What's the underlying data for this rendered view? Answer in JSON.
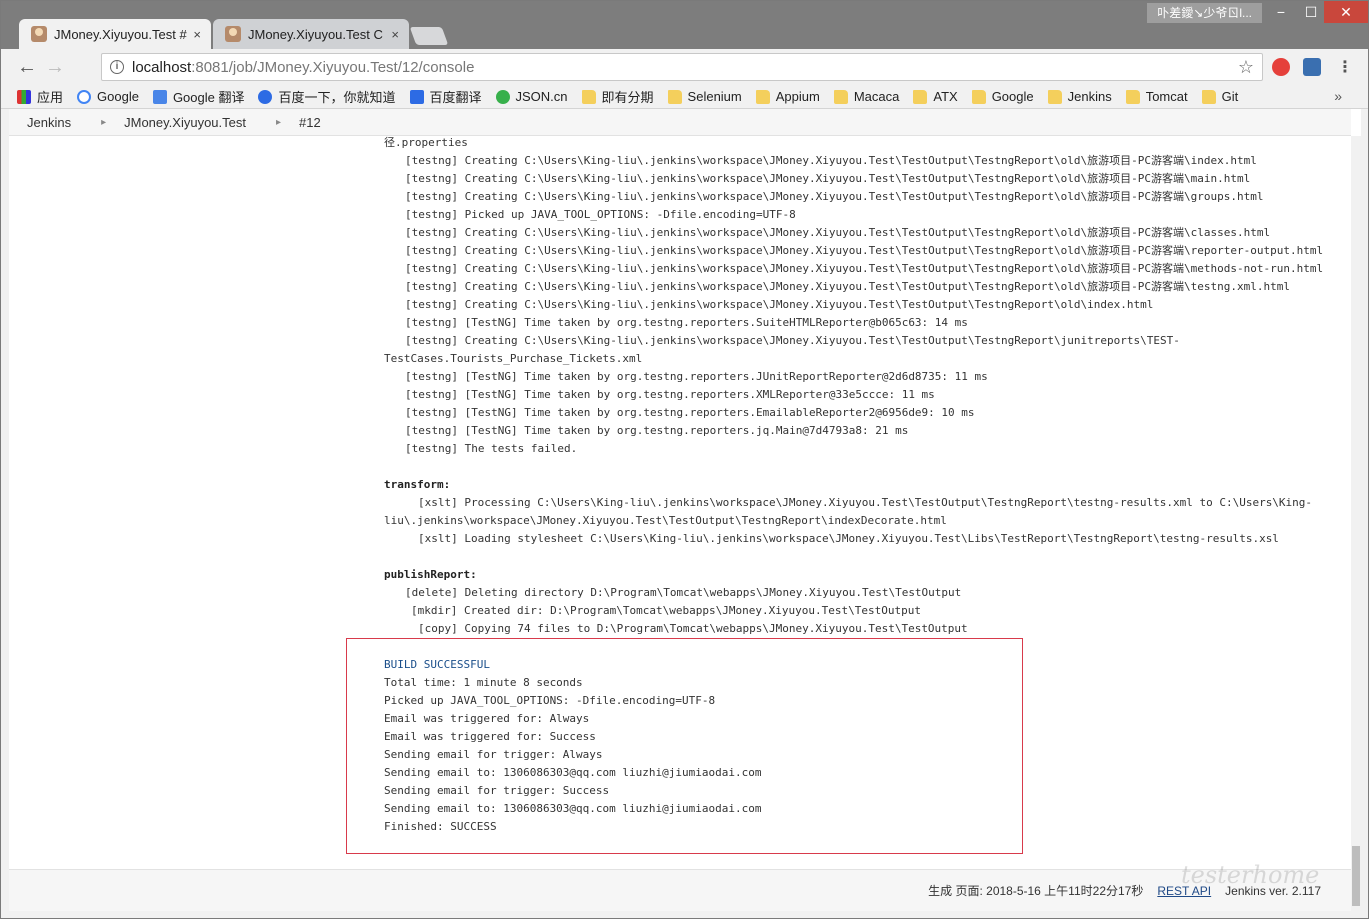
{
  "tabs": [
    {
      "title": "JMoney.Xiyuyou.Test #",
      "close": "×"
    },
    {
      "title": "JMoney.Xiyuyou.Test C",
      "close": "×"
    }
  ],
  "window": {
    "user": "卟差鑀↘少爷ㄖl...",
    "min": "−",
    "max": "☐",
    "close": "✕"
  },
  "toolbar": {
    "back": "←",
    "forward": "→",
    "reload": "C",
    "url_host": "localhost",
    "url_path": ":8081/job/JMoney.Xiyuyou.Test/12/console",
    "star": "☆",
    "menu": "⋮"
  },
  "bookmarks": {
    "items": [
      {
        "label": "应用",
        "icon": "apps-icon"
      },
      {
        "label": "Google",
        "icon": "google-icon"
      },
      {
        "label": "Google 翻译",
        "icon": "google-translate-icon"
      },
      {
        "label": "百度一下，你就知道",
        "icon": "baidu-icon"
      },
      {
        "label": "百度翻译",
        "icon": "baidu-translate-icon"
      },
      {
        "label": "JSON.cn",
        "icon": "json-icon"
      },
      {
        "label": "即有分期",
        "icon": "folder-icon"
      },
      {
        "label": "Selenium",
        "icon": "folder-icon"
      },
      {
        "label": "Appium",
        "icon": "folder-icon"
      },
      {
        "label": "Macaca",
        "icon": "folder-icon"
      },
      {
        "label": "ATX",
        "icon": "folder-icon"
      },
      {
        "label": "Google",
        "icon": "folder-icon"
      },
      {
        "label": "Jenkins",
        "icon": "folder-icon"
      },
      {
        "label": "Tomcat",
        "icon": "folder-icon"
      },
      {
        "label": "Git",
        "icon": "folder-icon"
      }
    ],
    "more": "»"
  },
  "breadcrumb": {
    "items": [
      "Jenkins",
      "JMoney.Xiyuyou.Test",
      "#12"
    ],
    "sep": "▸"
  },
  "console": {
    "lines": [
      {
        "text": "径.properties",
        "cls": ""
      },
      {
        "text": "[testng] Creating C:\\Users\\King-liu\\.jenkins\\workspace\\JMoney.Xiyuyou.Test\\TestOutput\\TestngReport\\old\\旅游项目-PC游客端\\index.html",
        "cls": "ind1"
      },
      {
        "text": "[testng] Creating C:\\Users\\King-liu\\.jenkins\\workspace\\JMoney.Xiyuyou.Test\\TestOutput\\TestngReport\\old\\旅游项目-PC游客端\\main.html",
        "cls": "ind1"
      },
      {
        "text": "[testng] Creating C:\\Users\\King-liu\\.jenkins\\workspace\\JMoney.Xiyuyou.Test\\TestOutput\\TestngReport\\old\\旅游项目-PC游客端\\groups.html",
        "cls": "ind1"
      },
      {
        "text": "[testng] Picked up JAVA_TOOL_OPTIONS: -Dfile.encoding=UTF-8",
        "cls": "ind1"
      },
      {
        "text": "[testng] Creating C:\\Users\\King-liu\\.jenkins\\workspace\\JMoney.Xiyuyou.Test\\TestOutput\\TestngReport\\old\\旅游项目-PC游客端\\classes.html",
        "cls": "ind1"
      },
      {
        "text": "[testng] Creating C:\\Users\\King-liu\\.jenkins\\workspace\\JMoney.Xiyuyou.Test\\TestOutput\\TestngReport\\old\\旅游项目-PC游客端\\reporter-output.html",
        "cls": "ind1"
      },
      {
        "text": "[testng] Creating C:\\Users\\King-liu\\.jenkins\\workspace\\JMoney.Xiyuyou.Test\\TestOutput\\TestngReport\\old\\旅游项目-PC游客端\\methods-not-run.html",
        "cls": "ind1"
      },
      {
        "text": "[testng] Creating C:\\Users\\King-liu\\.jenkins\\workspace\\JMoney.Xiyuyou.Test\\TestOutput\\TestngReport\\old\\旅游项目-PC游客端\\testng.xml.html",
        "cls": "ind1"
      },
      {
        "text": "[testng] Creating C:\\Users\\King-liu\\.jenkins\\workspace\\JMoney.Xiyuyou.Test\\TestOutput\\TestngReport\\old\\index.html",
        "cls": "ind1"
      },
      {
        "text": "[testng] [TestNG] Time taken by org.testng.reporters.SuiteHTMLReporter@b065c63: 14 ms",
        "cls": "ind1"
      },
      {
        "text": "[testng] Creating C:\\Users\\King-liu\\.jenkins\\workspace\\JMoney.Xiyuyou.Test\\TestOutput\\TestngReport\\junitreports\\TEST-",
        "cls": "ind1"
      },
      {
        "text": "TestCases.Tourists_Purchase_Tickets.xml",
        "cls": ""
      },
      {
        "text": "[testng] [TestNG] Time taken by org.testng.reporters.JUnitReportReporter@2d6d8735: 11 ms",
        "cls": "ind1"
      },
      {
        "text": "[testng] [TestNG] Time taken by org.testng.reporters.XMLReporter@33e5ccce: 11 ms",
        "cls": "ind1"
      },
      {
        "text": "[testng] [TestNG] Time taken by org.testng.reporters.EmailableReporter2@6956de9: 10 ms",
        "cls": "ind1"
      },
      {
        "text": "[testng] [TestNG] Time taken by org.testng.reporters.jq.Main@7d4793a8: 21 ms",
        "cls": "ind1"
      },
      {
        "text": "[testng] The tests failed.",
        "cls": "ind1"
      },
      {
        "text": "",
        "cls": "gap"
      },
      {
        "text": "transform:",
        "cls": "b"
      },
      {
        "text": "[xslt] Processing C:\\Users\\King-liu\\.jenkins\\workspace\\JMoney.Xiyuyou.Test\\TestOutput\\TestngReport\\testng-results.xml to C:\\Users\\King-",
        "cls": "ind2"
      },
      {
        "text": "liu\\.jenkins\\workspace\\JMoney.Xiyuyou.Test\\TestOutput\\TestngReport\\indexDecorate.html",
        "cls": ""
      },
      {
        "text": "[xslt] Loading stylesheet C:\\Users\\King-liu\\.jenkins\\workspace\\JMoney.Xiyuyou.Test\\Libs\\TestReport\\TestngReport\\testng-results.xsl",
        "cls": "ind2"
      },
      {
        "text": "",
        "cls": "gap"
      },
      {
        "text": "publishReport:",
        "cls": "b"
      },
      {
        "text": "[delete] Deleting directory D:\\Program\\Tomcat\\webapps\\JMoney.Xiyuyou.Test\\TestOutput",
        "cls": "ind1"
      },
      {
        "text": "[mkdir] Created dir: D:\\Program\\Tomcat\\webapps\\JMoney.Xiyuyou.Test\\TestOutput",
        "cls": "ind3"
      },
      {
        "text": "[copy] Copying 74 files to D:\\Program\\Tomcat\\webapps\\JMoney.Xiyuyou.Test\\TestOutput",
        "cls": "ind2"
      },
      {
        "text": "",
        "cls": "gap"
      },
      {
        "text": "BUILD SUCCESSFUL",
        "cls": "blue"
      },
      {
        "text": "Total time: 1 minute 8 seconds",
        "cls": ""
      },
      {
        "text": "Picked up JAVA_TOOL_OPTIONS: -Dfile.encoding=UTF-8",
        "cls": ""
      },
      {
        "text": "Email was triggered for: Always",
        "cls": ""
      },
      {
        "text": "Email was triggered for: Success",
        "cls": ""
      },
      {
        "text": "Sending email for trigger: Always",
        "cls": ""
      },
      {
        "text": "Sending email to: 1306086303@qq.com liuzhi@jiumiaodai.com",
        "cls": ""
      },
      {
        "text": "Sending email for trigger: Success",
        "cls": ""
      },
      {
        "text": "Sending email to: 1306086303@qq.com liuzhi@jiumiaodai.com",
        "cls": ""
      },
      {
        "text": "Finished: SUCCESS",
        "cls": ""
      }
    ]
  },
  "footer": {
    "generated": "生成 页面: 2018-5-16 上午11时22分17秒",
    "rest_api": "REST API",
    "version": "Jenkins ver. 2.117"
  },
  "watermark": "testerhome"
}
